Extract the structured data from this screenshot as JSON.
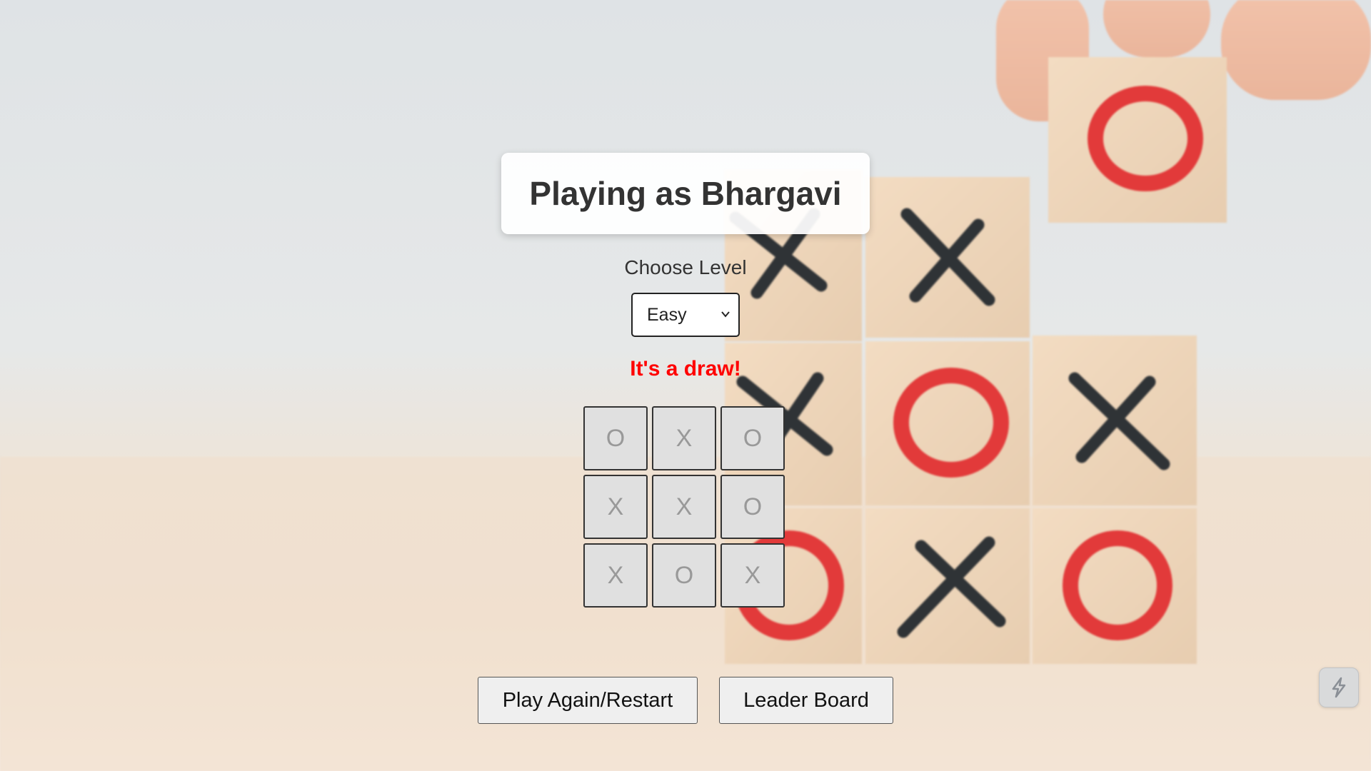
{
  "header": {
    "title": "Playing as Bhargavi"
  },
  "level": {
    "label": "Choose Level",
    "selected": "Easy"
  },
  "status_text": "It's a draw!",
  "board": {
    "cells": [
      "O",
      "X",
      "O",
      "X",
      "X",
      "O",
      "X",
      "O",
      "X"
    ]
  },
  "buttons": {
    "restart_label": "Play Again/Restart",
    "leaderboard_label": "Leader Board"
  },
  "widget": {
    "icon": "lightning-icon"
  },
  "colors": {
    "status": "#ff0000",
    "mark_red": "#e23a3a",
    "mark_dark": "#2f3336"
  }
}
